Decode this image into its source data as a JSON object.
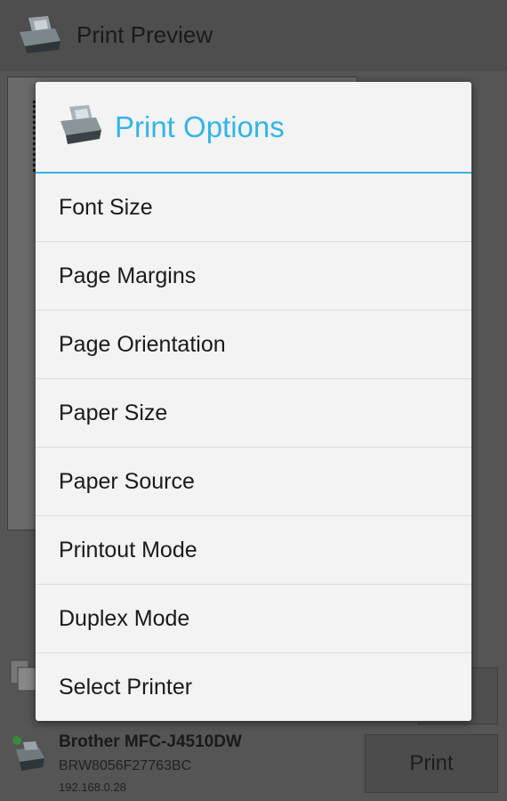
{
  "appbar": {
    "title": "Print Preview",
    "icon": "printer-app-icon"
  },
  "bottom": {
    "printer_name": "Brother MFC-J4510DW",
    "printer_id": "BRW8056F27763BC",
    "printer_ip": "192.168.0.28",
    "print_label": "Print"
  },
  "dialog": {
    "title": "Print Options",
    "accent": "#33b5e5",
    "items": [
      {
        "label": "Font Size"
      },
      {
        "label": "Page Margins"
      },
      {
        "label": "Page Orientation"
      },
      {
        "label": "Paper Size"
      },
      {
        "label": "Paper Source"
      },
      {
        "label": "Printout Mode"
      },
      {
        "label": "Duplex Mode"
      },
      {
        "label": "Select Printer"
      }
    ]
  }
}
